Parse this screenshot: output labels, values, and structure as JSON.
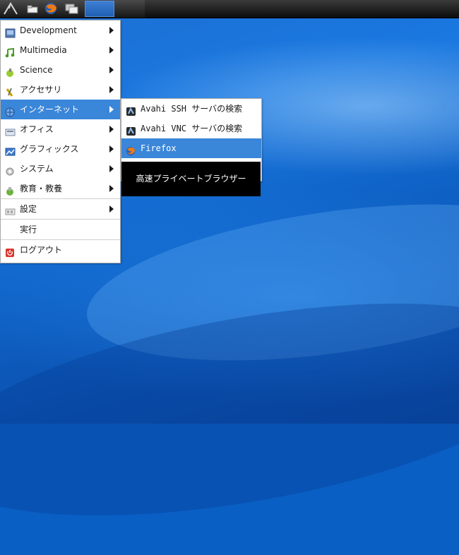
{
  "panel": {
    "buttons": [
      {
        "icon": "lxde-menu-icon"
      },
      {
        "icon": "file-manager-icon"
      },
      {
        "icon": "firefox-icon"
      },
      {
        "icon": "show-desktop-icon"
      }
    ]
  },
  "main_menu": {
    "items": [
      {
        "label": "Development",
        "icon": "development-icon",
        "submenu": true
      },
      {
        "label": "Multimedia",
        "icon": "multimedia-icon",
        "submenu": true
      },
      {
        "label": "Science",
        "icon": "science-icon",
        "submenu": true
      },
      {
        "label": "アクセサリ",
        "icon": "accessories-icon",
        "submenu": true
      },
      {
        "label": "インターネット",
        "icon": "internet-icon",
        "submenu": true,
        "active": true
      },
      {
        "label": "オフィス",
        "icon": "office-icon",
        "submenu": true
      },
      {
        "label": "グラフィックス",
        "icon": "graphics-icon",
        "submenu": true
      },
      {
        "label": "システム",
        "icon": "system-icon",
        "submenu": true
      },
      {
        "label": "教育・教養",
        "icon": "education-icon",
        "submenu": true
      },
      {
        "label": "設定",
        "icon": "preferences-icon",
        "submenu": true
      },
      {
        "label": "実行",
        "icon": "",
        "submenu": false
      },
      {
        "label": "ログアウト",
        "icon": "logout-icon",
        "submenu": false
      }
    ]
  },
  "internet_submenu": {
    "items": [
      {
        "label": "Avahi SSH サーバの検索",
        "icon": "avahi-icon"
      },
      {
        "label": "Avahi VNC サーバの検索",
        "icon": "avahi-icon"
      },
      {
        "label": "Firefox",
        "icon": "firefox-icon",
        "active": true
      }
    ]
  },
  "tooltip": {
    "text": "高速プライベートブラウザー"
  },
  "colors": {
    "highlight": "#3a86d9",
    "tooltip_bg": "#000000",
    "panel": "#1a1a1a"
  }
}
